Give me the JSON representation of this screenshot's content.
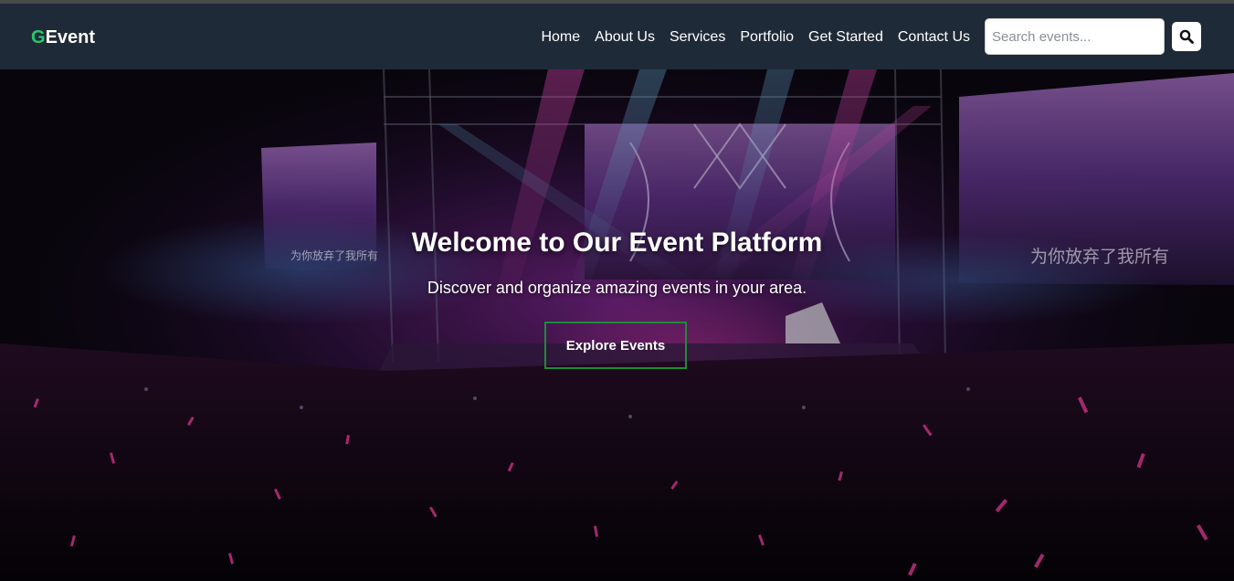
{
  "colors": {
    "nav_bg": "#1f2a38",
    "brand_accent": "#28c76f",
    "button_border": "#1e8a3a"
  },
  "brand": {
    "first_letter": "G",
    "rest": "Event"
  },
  "nav": {
    "links": [
      "Home",
      "About Us",
      "Services",
      "Portfolio",
      "Get Started",
      "Contact Us"
    ]
  },
  "search": {
    "placeholder": "Search events...",
    "icon": "search-icon"
  },
  "hero": {
    "title": "Welcome to Our Event Platform",
    "subtitle": "Discover and organize amazing events in your area.",
    "cta_label": "Explore Events",
    "background": "concert-stage-photo",
    "screen_text_left": "为你放弃了我所有",
    "screen_text_right": "为你放弃了我所有"
  }
}
